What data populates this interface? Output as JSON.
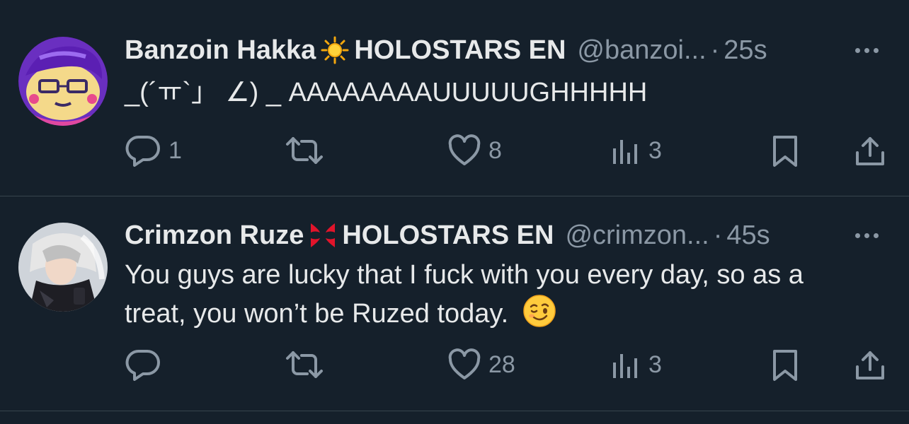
{
  "tweets": [
    {
      "author": {
        "display_name": "Banzoin Hakka",
        "emblem": "sun-emoji-icon",
        "unit": "HOLOSTARS EN",
        "handle": "@banzoi...",
        "separator": "·",
        "time": "25s"
      },
      "text": "_(´ㅠ`」 ∠) _ AAAAAAAAUUUUUGHHHHH",
      "actions": {
        "reply_count": "1",
        "retweet_count": "",
        "like_count": "8",
        "view_count": "3"
      }
    },
    {
      "author": {
        "display_name": "Crimzon Ruze",
        "emblem": "anger-symbol-emoji-icon",
        "unit": "HOLOSTARS EN",
        "handle": "@crimzon...",
        "separator": "·",
        "time": "45s"
      },
      "text_line_1": "You guys are lucky that I fuck with you every day, so as a",
      "text_line_2": "treat, you won’t be Ruzed today.",
      "text_emoji": "winking-face-emoji-icon",
      "actions": {
        "reply_count": "",
        "retweet_count": "",
        "like_count": "28",
        "view_count": "3"
      }
    }
  ],
  "colors": {
    "background": "#15202b",
    "text_primary": "#e7e9ea",
    "text_secondary": "#8b98a5",
    "divider": "#38444d"
  }
}
